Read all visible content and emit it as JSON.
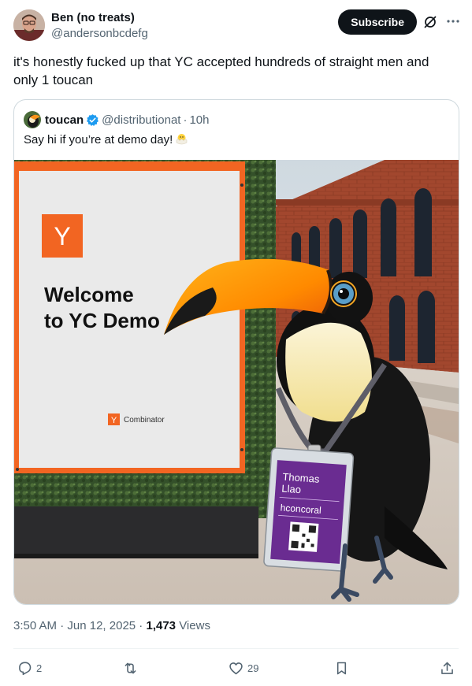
{
  "post": {
    "author_name": "Ben (no treats)",
    "author_handle": "@andersonbcdefg",
    "subscribe_label": "Subscribe",
    "text": "it's honestly fucked up that YC accepted hundreds of straight men and only 1 toucan"
  },
  "quote": {
    "author_name": "toucan",
    "author_handle": "@distributionat",
    "separator": "·",
    "time": "10h",
    "text": "Say hi if you’re at demo day!",
    "image": {
      "sign_logo": "Y",
      "sign_line1": "Welcome",
      "sign_line2": "to YC Demo",
      "sign_footer_logo": "Y",
      "sign_footer_text": "Combinator",
      "badge_line1": "Thomas",
      "badge_line2": "Llao",
      "badge_line3": "hconcoral"
    }
  },
  "meta": {
    "time": "3:50 AM",
    "dot1": " · ",
    "date": "Jun 12, 2025",
    "dot2": " · ",
    "views_count": "1,473",
    "views_label": " Views"
  },
  "actions": {
    "replies": "2",
    "reposts": "",
    "likes": "29"
  },
  "icons": {
    "reply": "reply-icon",
    "repost": "repost-icon",
    "like": "heart-icon",
    "bookmark": "bookmark-icon",
    "share": "share-icon",
    "grok": "grok-icon",
    "more": "more-icon",
    "verified": "verified-badge-icon"
  },
  "colors": {
    "verified_blue": "#1d9bf0",
    "subscribe_bg": "#0f1419",
    "yc_orange": "#f26522",
    "badge_purple": "#6a2c91"
  }
}
